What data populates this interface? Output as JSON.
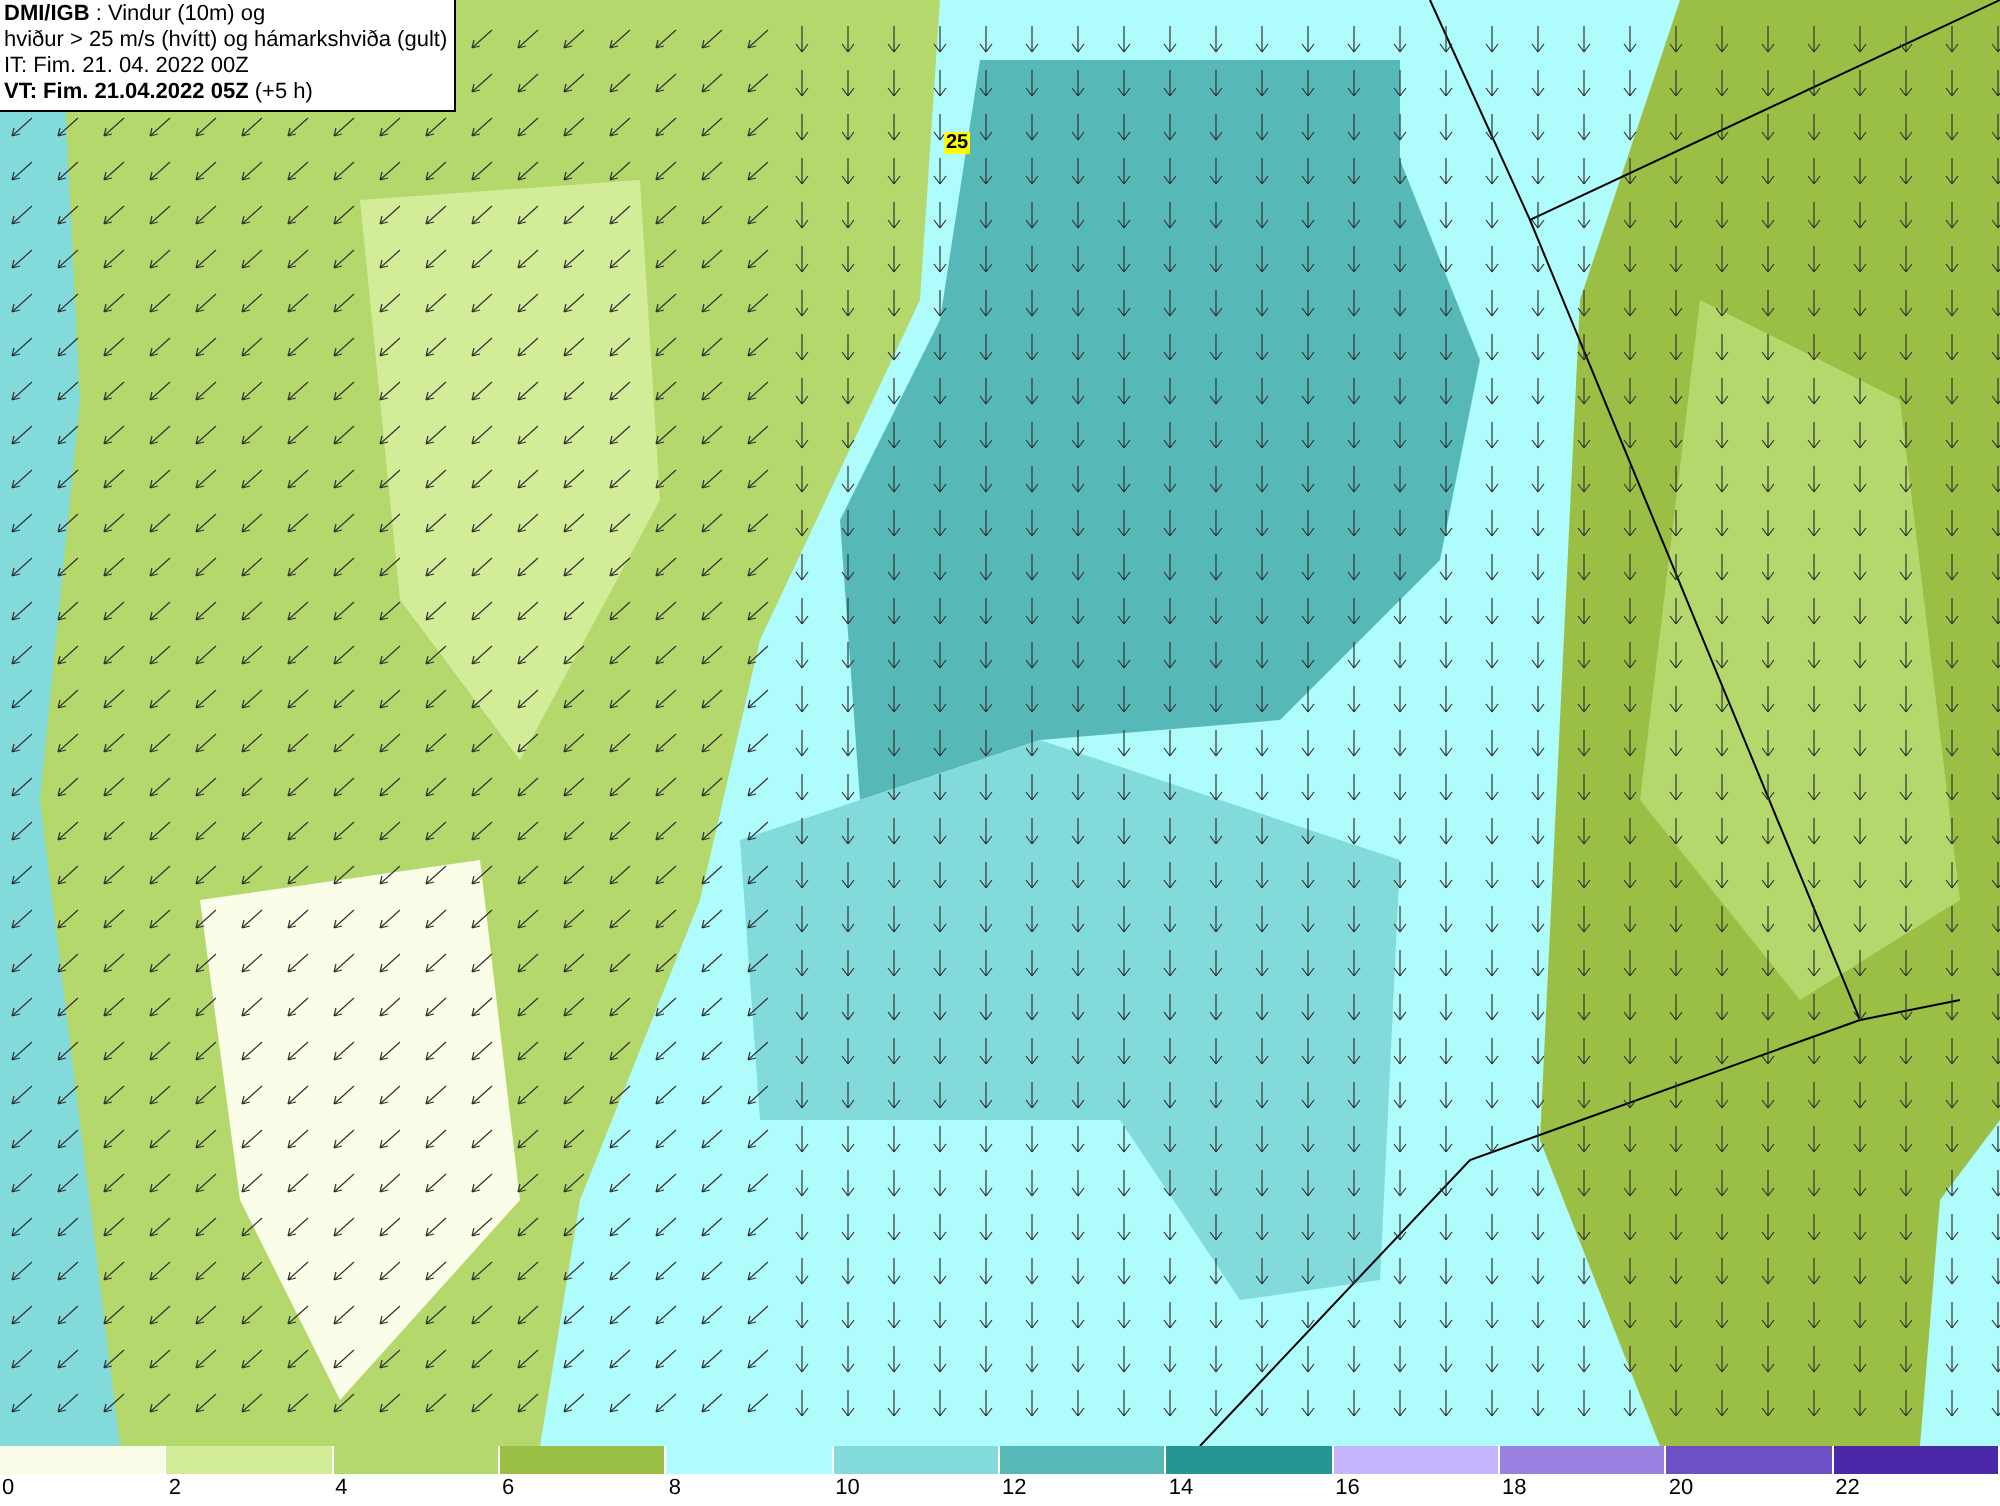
{
  "header": {
    "source": "DMI/IGB",
    "title": " : Vindur (10m) og",
    "subtitle": "hviður > 25 m/s (hvítt) og hámarkshviða (gult)",
    "issue_time": "IT: Fim. 21. 04. 2022 00Z",
    "valid_time": "VT: Fim. 21.04.2022 05Z",
    "offset": " (+5 h)"
  },
  "map": {
    "gust_marker": "25"
  },
  "legend": [
    {
      "label": "0",
      "color": "#fafee8"
    },
    {
      "label": "2",
      "color": "#d2ec98"
    },
    {
      "label": "4",
      "color": "#b4d86c"
    },
    {
      "label": "6",
      "color": "#9bbf44"
    },
    {
      "label": "8",
      "color": "#aefcfc"
    },
    {
      "label": "10",
      "color": "#82dada"
    },
    {
      "label": "12",
      "color": "#57b8b8"
    },
    {
      "label": "14",
      "color": "#259693"
    },
    {
      "label": "16",
      "color": "#c6b4fc"
    },
    {
      "label": "18",
      "color": "#9a82e2"
    },
    {
      "label": "20",
      "color": "#6e50c6"
    },
    {
      "label": "22",
      "color": "#4a28a8"
    }
  ]
}
